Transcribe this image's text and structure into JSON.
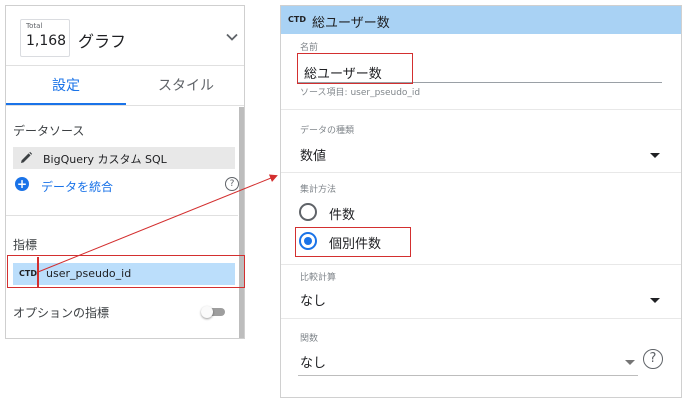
{
  "left_panel": {
    "total_label": "Total",
    "total_value": "1,168",
    "chart_title": "グラフ",
    "icons": {
      "chevron": "chevron-down-icon",
      "pencil": "pencil-icon",
      "add": "add-circle-icon",
      "help": "help-icon"
    },
    "tabs": [
      {
        "label": "設定",
        "active": true
      },
      {
        "label": "スタイル",
        "active": false
      }
    ],
    "data_source_heading": "データソース",
    "data_source_name": "BigQuery カスタム SQL",
    "blend_label": "データを統合",
    "metric_heading": "指標",
    "metric_badge": "CTD",
    "metric_name": "user_pseudo_id",
    "optional_metrics_label": "オプションの指標",
    "optional_metrics_enabled": false
  },
  "right_panel": {
    "header_badge": "CTD",
    "header_title": "総ユーザー数",
    "name_label": "名前",
    "name_value": "総ユーザー数",
    "source_field": "ソース項目: user_pseudo_id",
    "data_type_label": "データの種類",
    "data_type_value": "数値",
    "aggregation_label": "集計方法",
    "aggregation_options": [
      {
        "label": "件数",
        "selected": false
      },
      {
        "label": "個別件数",
        "selected": true
      }
    ],
    "comparison_label": "比較計算",
    "comparison_value": "なし",
    "function_label": "関数",
    "function_value": "なし",
    "help_glyph": "?"
  },
  "colors": {
    "accent": "#1a73e8",
    "header_bg": "#a9d2f4",
    "metric_chip_bg": "#bbdefb",
    "annotation_red": "#d32f2f"
  }
}
